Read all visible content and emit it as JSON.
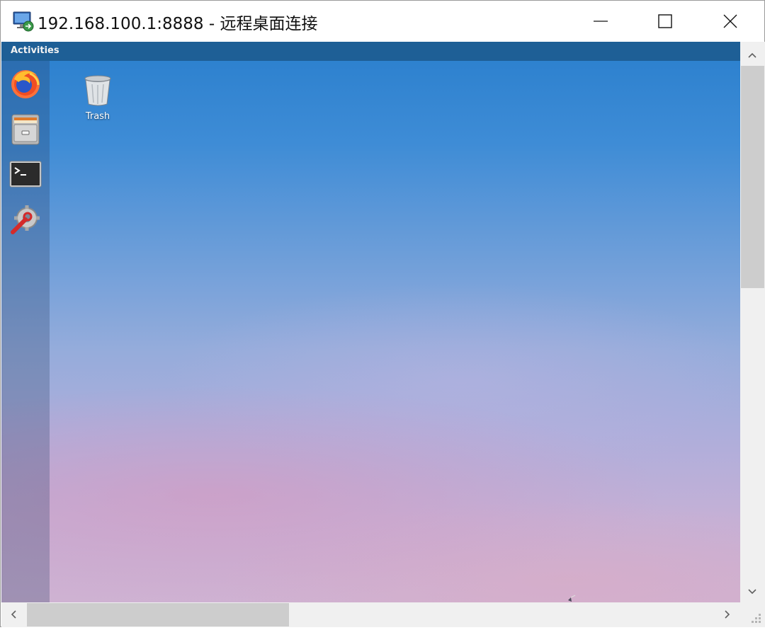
{
  "window": {
    "title": "192.168.100.1:8888 - 远程桌面连接",
    "app_icon": "remote-desktop-icon",
    "controls": [
      "minimize-icon",
      "maximize-icon",
      "close-icon"
    ]
  },
  "remote_desktop": {
    "topbar": {
      "activities_label": "Activities"
    },
    "dock": {
      "items": [
        {
          "name": "Firefox",
          "icon": "firefox-icon"
        },
        {
          "name": "Files",
          "icon": "file-cabinet-icon"
        },
        {
          "name": "Terminal",
          "icon": "terminal-icon"
        },
        {
          "name": "Settings",
          "icon": "settings-wrench-icon"
        }
      ]
    },
    "desktop_icons": [
      {
        "label": "Trash",
        "icon": "trash-icon"
      }
    ]
  },
  "scrollbars": {
    "vertical": {
      "position_fraction": 0.0,
      "visible_fraction": 0.43
    },
    "horizontal": {
      "position_fraction": 0.0,
      "visible_fraction": 0.38
    }
  },
  "colors": {
    "topbar": "#1e5f96",
    "sky_top": "#2a7fcd",
    "sky_bottom": "#cfb2d2"
  }
}
